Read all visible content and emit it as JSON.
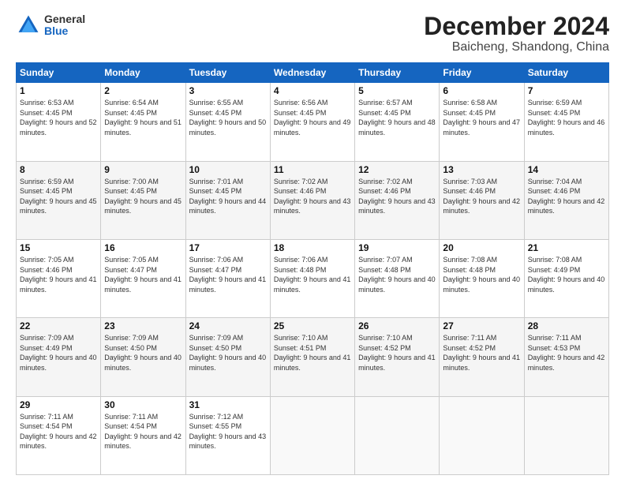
{
  "logo": {
    "general": "General",
    "blue": "Blue"
  },
  "title": "December 2024",
  "subtitle": "Baicheng, Shandong, China",
  "days_header": [
    "Sunday",
    "Monday",
    "Tuesday",
    "Wednesday",
    "Thursday",
    "Friday",
    "Saturday"
  ],
  "weeks": [
    [
      {
        "day": "1",
        "sunrise": "Sunrise: 6:53 AM",
        "sunset": "Sunset: 4:45 PM",
        "daylight": "Daylight: 9 hours and 52 minutes."
      },
      {
        "day": "2",
        "sunrise": "Sunrise: 6:54 AM",
        "sunset": "Sunset: 4:45 PM",
        "daylight": "Daylight: 9 hours and 51 minutes."
      },
      {
        "day": "3",
        "sunrise": "Sunrise: 6:55 AM",
        "sunset": "Sunset: 4:45 PM",
        "daylight": "Daylight: 9 hours and 50 minutes."
      },
      {
        "day": "4",
        "sunrise": "Sunrise: 6:56 AM",
        "sunset": "Sunset: 4:45 PM",
        "daylight": "Daylight: 9 hours and 49 minutes."
      },
      {
        "day": "5",
        "sunrise": "Sunrise: 6:57 AM",
        "sunset": "Sunset: 4:45 PM",
        "daylight": "Daylight: 9 hours and 48 minutes."
      },
      {
        "day": "6",
        "sunrise": "Sunrise: 6:58 AM",
        "sunset": "Sunset: 4:45 PM",
        "daylight": "Daylight: 9 hours and 47 minutes."
      },
      {
        "day": "7",
        "sunrise": "Sunrise: 6:59 AM",
        "sunset": "Sunset: 4:45 PM",
        "daylight": "Daylight: 9 hours and 46 minutes."
      }
    ],
    [
      {
        "day": "8",
        "sunrise": "Sunrise: 6:59 AM",
        "sunset": "Sunset: 4:45 PM",
        "daylight": "Daylight: 9 hours and 45 minutes."
      },
      {
        "day": "9",
        "sunrise": "Sunrise: 7:00 AM",
        "sunset": "Sunset: 4:45 PM",
        "daylight": "Daylight: 9 hours and 45 minutes."
      },
      {
        "day": "10",
        "sunrise": "Sunrise: 7:01 AM",
        "sunset": "Sunset: 4:45 PM",
        "daylight": "Daylight: 9 hours and 44 minutes."
      },
      {
        "day": "11",
        "sunrise": "Sunrise: 7:02 AM",
        "sunset": "Sunset: 4:46 PM",
        "daylight": "Daylight: 9 hours and 43 minutes."
      },
      {
        "day": "12",
        "sunrise": "Sunrise: 7:02 AM",
        "sunset": "Sunset: 4:46 PM",
        "daylight": "Daylight: 9 hours and 43 minutes."
      },
      {
        "day": "13",
        "sunrise": "Sunrise: 7:03 AM",
        "sunset": "Sunset: 4:46 PM",
        "daylight": "Daylight: 9 hours and 42 minutes."
      },
      {
        "day": "14",
        "sunrise": "Sunrise: 7:04 AM",
        "sunset": "Sunset: 4:46 PM",
        "daylight": "Daylight: 9 hours and 42 minutes."
      }
    ],
    [
      {
        "day": "15",
        "sunrise": "Sunrise: 7:05 AM",
        "sunset": "Sunset: 4:46 PM",
        "daylight": "Daylight: 9 hours and 41 minutes."
      },
      {
        "day": "16",
        "sunrise": "Sunrise: 7:05 AM",
        "sunset": "Sunset: 4:47 PM",
        "daylight": "Daylight: 9 hours and 41 minutes."
      },
      {
        "day": "17",
        "sunrise": "Sunrise: 7:06 AM",
        "sunset": "Sunset: 4:47 PM",
        "daylight": "Daylight: 9 hours and 41 minutes."
      },
      {
        "day": "18",
        "sunrise": "Sunrise: 7:06 AM",
        "sunset": "Sunset: 4:48 PM",
        "daylight": "Daylight: 9 hours and 41 minutes."
      },
      {
        "day": "19",
        "sunrise": "Sunrise: 7:07 AM",
        "sunset": "Sunset: 4:48 PM",
        "daylight": "Daylight: 9 hours and 40 minutes."
      },
      {
        "day": "20",
        "sunrise": "Sunrise: 7:08 AM",
        "sunset": "Sunset: 4:48 PM",
        "daylight": "Daylight: 9 hours and 40 minutes."
      },
      {
        "day": "21",
        "sunrise": "Sunrise: 7:08 AM",
        "sunset": "Sunset: 4:49 PM",
        "daylight": "Daylight: 9 hours and 40 minutes."
      }
    ],
    [
      {
        "day": "22",
        "sunrise": "Sunrise: 7:09 AM",
        "sunset": "Sunset: 4:49 PM",
        "daylight": "Daylight: 9 hours and 40 minutes."
      },
      {
        "day": "23",
        "sunrise": "Sunrise: 7:09 AM",
        "sunset": "Sunset: 4:50 PM",
        "daylight": "Daylight: 9 hours and 40 minutes."
      },
      {
        "day": "24",
        "sunrise": "Sunrise: 7:09 AM",
        "sunset": "Sunset: 4:50 PM",
        "daylight": "Daylight: 9 hours and 40 minutes."
      },
      {
        "day": "25",
        "sunrise": "Sunrise: 7:10 AM",
        "sunset": "Sunset: 4:51 PM",
        "daylight": "Daylight: 9 hours and 41 minutes."
      },
      {
        "day": "26",
        "sunrise": "Sunrise: 7:10 AM",
        "sunset": "Sunset: 4:52 PM",
        "daylight": "Daylight: 9 hours and 41 minutes."
      },
      {
        "day": "27",
        "sunrise": "Sunrise: 7:11 AM",
        "sunset": "Sunset: 4:52 PM",
        "daylight": "Daylight: 9 hours and 41 minutes."
      },
      {
        "day": "28",
        "sunrise": "Sunrise: 7:11 AM",
        "sunset": "Sunset: 4:53 PM",
        "daylight": "Daylight: 9 hours and 42 minutes."
      }
    ],
    [
      {
        "day": "29",
        "sunrise": "Sunrise: 7:11 AM",
        "sunset": "Sunset: 4:54 PM",
        "daylight": "Daylight: 9 hours and 42 minutes."
      },
      {
        "day": "30",
        "sunrise": "Sunrise: 7:11 AM",
        "sunset": "Sunset: 4:54 PM",
        "daylight": "Daylight: 9 hours and 42 minutes."
      },
      {
        "day": "31",
        "sunrise": "Sunrise: 7:12 AM",
        "sunset": "Sunset: 4:55 PM",
        "daylight": "Daylight: 9 hours and 43 minutes."
      },
      null,
      null,
      null,
      null
    ]
  ]
}
